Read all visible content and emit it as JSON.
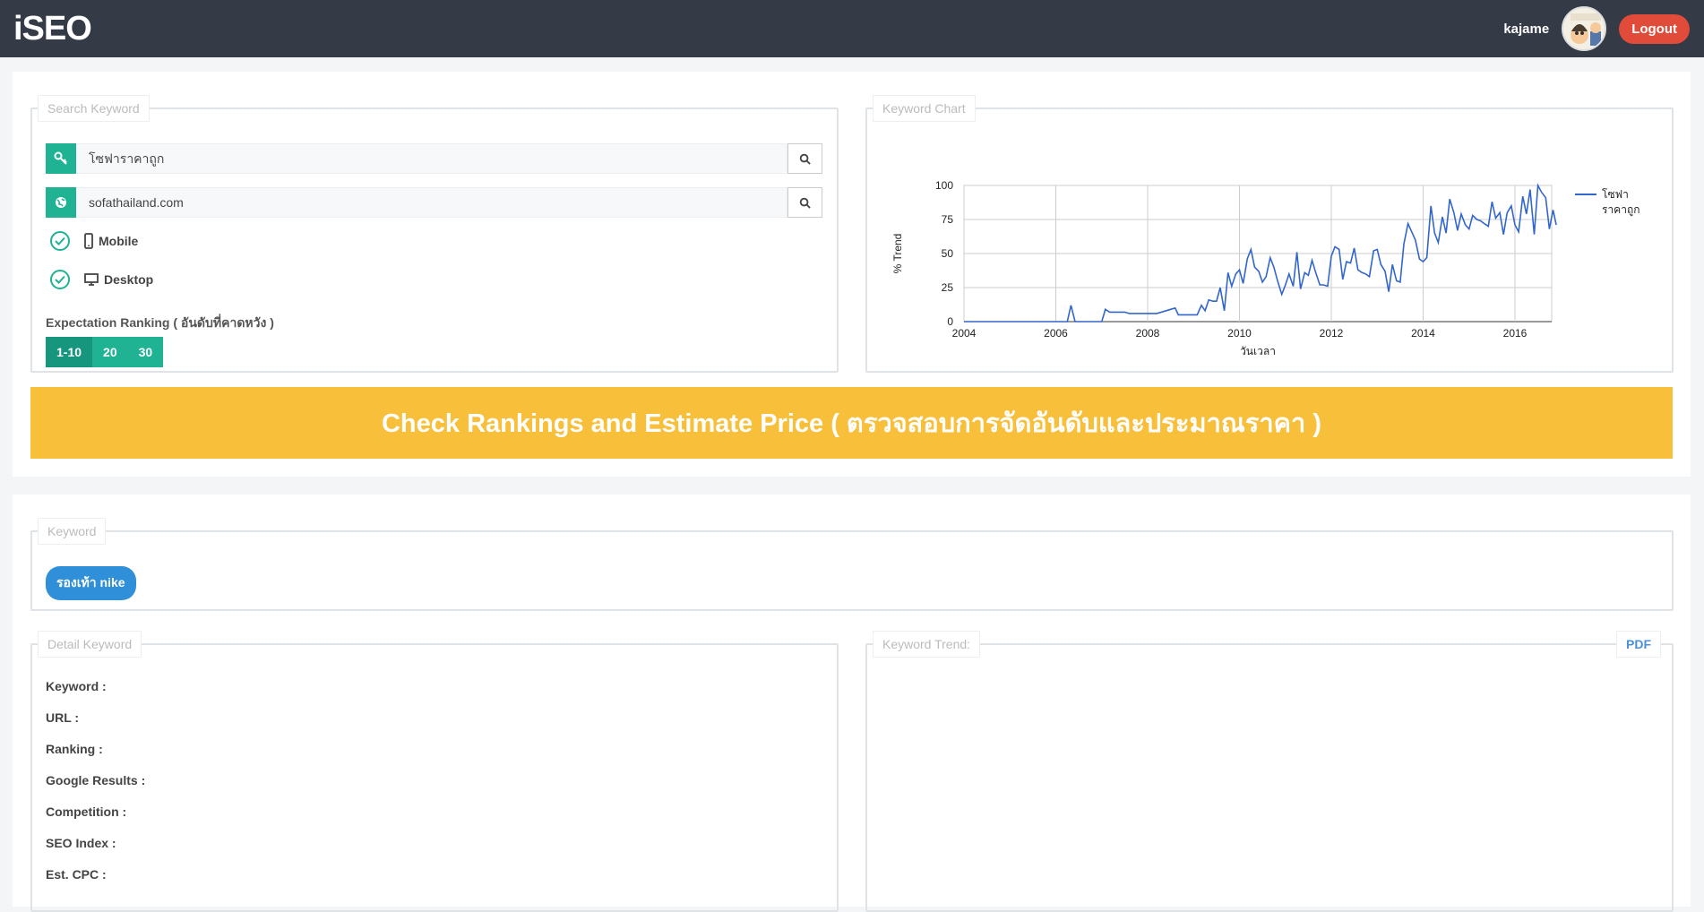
{
  "header": {
    "brand": "iSEO",
    "username": "kajame",
    "logout_label": "Logout"
  },
  "search": {
    "legend": "Search Keyword",
    "keyword_value": "โซฟาราคาถูก",
    "domain_value": "sofathailand.com",
    "mobile_label": "Mobile",
    "desktop_label": "Desktop",
    "expectation_label": "Expectation Ranking ( อันดับที่คาดหวัง )",
    "ranking_options": [
      "1-10",
      "20",
      "30"
    ],
    "ranking_selected": "1-10"
  },
  "chart_panel": {
    "legend": "Keyword Chart"
  },
  "chart_data": {
    "type": "line",
    "xlabel": "วันเวลา",
    "ylabel": "% Trend",
    "xlim": [
      2004,
      2016.8
    ],
    "ylim": [
      0,
      100
    ],
    "x_ticks": [
      "2004",
      "2006",
      "2008",
      "2010",
      "2012",
      "2014",
      "2016"
    ],
    "y_ticks": [
      "0",
      "25",
      "50",
      "75",
      "100"
    ],
    "grid": true,
    "legend_position": "right",
    "series": [
      {
        "name": "โซฟาราคาถูก",
        "color": "#3366cc",
        "points": [
          [
            2004.0,
            0
          ],
          [
            2006.25,
            0
          ],
          [
            2006.33,
            12
          ],
          [
            2006.42,
            0
          ],
          [
            2007.0,
            0
          ],
          [
            2007.08,
            9
          ],
          [
            2007.17,
            7
          ],
          [
            2007.5,
            7
          ],
          [
            2007.6,
            6
          ],
          [
            2008.2,
            6
          ],
          [
            2008.5,
            9
          ],
          [
            2008.6,
            10
          ],
          [
            2008.67,
            5
          ],
          [
            2009.0,
            5
          ],
          [
            2009.08,
            5
          ],
          [
            2009.17,
            12
          ],
          [
            2009.25,
            8
          ],
          [
            2009.33,
            16
          ],
          [
            2009.42,
            15
          ],
          [
            2009.5,
            15
          ],
          [
            2009.58,
            25
          ],
          [
            2009.67,
            8
          ],
          [
            2009.75,
            36
          ],
          [
            2009.83,
            26
          ],
          [
            2009.92,
            35
          ],
          [
            2010.0,
            38
          ],
          [
            2010.08,
            28
          ],
          [
            2010.17,
            46
          ],
          [
            2010.25,
            53
          ],
          [
            2010.33,
            40
          ],
          [
            2010.42,
            37
          ],
          [
            2010.5,
            29
          ],
          [
            2010.58,
            33
          ],
          [
            2010.67,
            47
          ],
          [
            2010.75,
            40
          ],
          [
            2010.83,
            30
          ],
          [
            2010.92,
            20
          ],
          [
            2011.0,
            27
          ],
          [
            2011.08,
            35
          ],
          [
            2011.17,
            26
          ],
          [
            2011.25,
            51
          ],
          [
            2011.33,
            24
          ],
          [
            2011.42,
            36
          ],
          [
            2011.5,
            34
          ],
          [
            2011.58,
            45
          ],
          [
            2011.67,
            35
          ],
          [
            2011.75,
            27
          ],
          [
            2011.83,
            27
          ],
          [
            2011.92,
            26
          ],
          [
            2012.0,
            48
          ],
          [
            2012.08,
            55
          ],
          [
            2012.17,
            53
          ],
          [
            2012.25,
            31
          ],
          [
            2012.33,
            44
          ],
          [
            2012.42,
            43
          ],
          [
            2012.5,
            54
          ],
          [
            2012.58,
            38
          ],
          [
            2012.67,
            36
          ],
          [
            2012.75,
            35
          ],
          [
            2012.83,
            33
          ],
          [
            2012.92,
            52
          ],
          [
            2013.0,
            53
          ],
          [
            2013.08,
            42
          ],
          [
            2013.17,
            37
          ],
          [
            2013.25,
            22
          ],
          [
            2013.33,
            42
          ],
          [
            2013.42,
            30
          ],
          [
            2013.5,
            29
          ],
          [
            2013.58,
            57
          ],
          [
            2013.67,
            72
          ],
          [
            2013.75,
            66
          ],
          [
            2013.83,
            60
          ],
          [
            2013.92,
            46
          ],
          [
            2014.0,
            44
          ],
          [
            2014.08,
            47
          ],
          [
            2014.17,
            85
          ],
          [
            2014.25,
            65
          ],
          [
            2014.33,
            58
          ],
          [
            2014.42,
            77
          ],
          [
            2014.5,
            65
          ],
          [
            2014.58,
            90
          ],
          [
            2014.67,
            80
          ],
          [
            2014.75,
            67
          ],
          [
            2014.83,
            79
          ],
          [
            2014.92,
            71
          ],
          [
            2015.0,
            68
          ],
          [
            2015.08,
            78
          ],
          [
            2015.17,
            75
          ],
          [
            2015.25,
            74
          ],
          [
            2015.33,
            72
          ],
          [
            2015.42,
            70
          ],
          [
            2015.5,
            88
          ],
          [
            2015.58,
            76
          ],
          [
            2015.67,
            80
          ],
          [
            2015.75,
            64
          ],
          [
            2015.83,
            80
          ],
          [
            2015.92,
            85
          ],
          [
            2016.0,
            71
          ],
          [
            2016.08,
            66
          ],
          [
            2016.17,
            92
          ],
          [
            2016.25,
            79
          ],
          [
            2016.33,
            97
          ],
          [
            2016.42,
            64
          ],
          [
            2016.5,
            100
          ],
          [
            2016.58,
            95
          ],
          [
            2016.67,
            91
          ],
          [
            2016.75,
            68
          ],
          [
            2016.83,
            82
          ],
          [
            2016.9,
            71
          ]
        ]
      }
    ]
  },
  "cta": {
    "label": "Check Rankings and Estimate Price ( ตรวจสอบการจัดอันดับและประมาณราคา )"
  },
  "keyword_panel": {
    "legend": "Keyword",
    "chip": "รองเท้า nike"
  },
  "detail_panel": {
    "legend": "Detail Keyword",
    "items": [
      "Keyword :",
      "URL :",
      "Ranking :",
      "Google Results :",
      "Competition :",
      "SEO Index :",
      "Est. CPC :"
    ]
  },
  "trend_panel": {
    "legend": "Keyword Trend:",
    "pdf_label": "PDF"
  },
  "colors": {
    "topbar": "#343a46",
    "accent": "#1fb394",
    "cta": "#f8bf3a",
    "logout": "#e04b3a",
    "chip": "#2f8fd8"
  }
}
